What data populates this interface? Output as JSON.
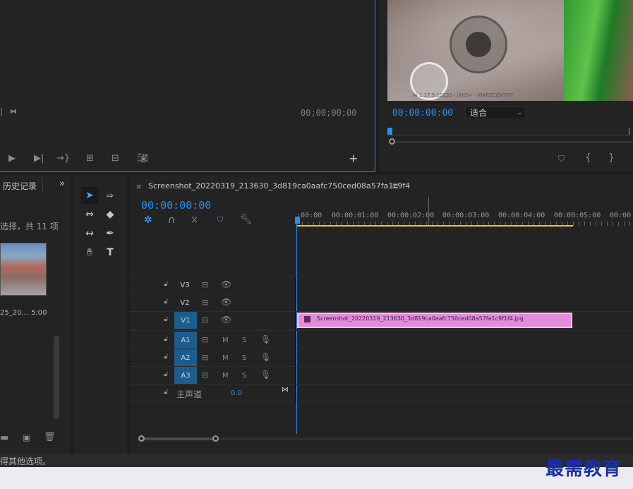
{
  "source_monitor": {
    "timecode": "00;00;00;00"
  },
  "program_monitor": {
    "timecode": "00:00:00:00",
    "fit_select": "适合",
    "video_overlay_text": "Ai 1.17.5.10233 - jjHtS< - WARZCENTSIT"
  },
  "project_panel": {
    "tab_label": "历史记录",
    "selection_text": "选择，共 11 项",
    "clip_name": "25_20...",
    "clip_duration": "5:00",
    "status_text": "得其他选项。"
  },
  "timeline": {
    "sequence_tab": "Screenshot_20220319_213630_3d819ca0aafc750ced08a57fa1c9f4",
    "timecode": "00:00:00:00",
    "ruler_labels": [
      ":00:00",
      "00:00:01:00",
      "00:00:02:00",
      "00:00:03:00",
      "00:00:04:00",
      "00:00:05:00",
      "00:00"
    ],
    "video_tracks": [
      "V3",
      "V2",
      "V1"
    ],
    "audio_tracks": [
      "A1",
      "A2",
      "A3"
    ],
    "master_label": "主声道",
    "master_value": "0.0",
    "m_label": "M",
    "s_label": "S",
    "clip_label": "Screenshot_20220319_213630_3d819ca0aafc750ced08a57fa1c9f1f4.jpg"
  },
  "watermark": "最需教育",
  "colors": {
    "accent_blue": "#2d8ceb",
    "clip_pink": "#e58bdb",
    "track_target": "#1c5d8c",
    "work_area_yellow": "#e8d000"
  }
}
